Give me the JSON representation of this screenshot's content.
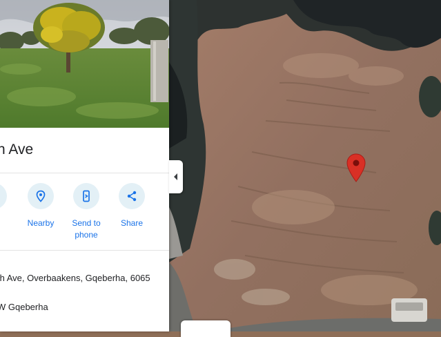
{
  "place": {
    "title": "n Ave"
  },
  "actions": [
    {
      "label": "e",
      "icon": "save-icon"
    },
    {
      "label": "Nearby",
      "icon": "nearby-pin-icon"
    },
    {
      "label": "Send to\nphone",
      "icon": "send-to-phone-icon"
    },
    {
      "label": "Share",
      "icon": "share-icon"
    }
  ],
  "details": {
    "address": "th Ave, Overbaakens, Gqeberha, 6065",
    "plus_code": "W Gqeberha"
  },
  "colors": {
    "accent": "#1a73e8",
    "action_circle": "#e3f0f6",
    "pin": "#d93025",
    "dirt": "#9b7460"
  }
}
